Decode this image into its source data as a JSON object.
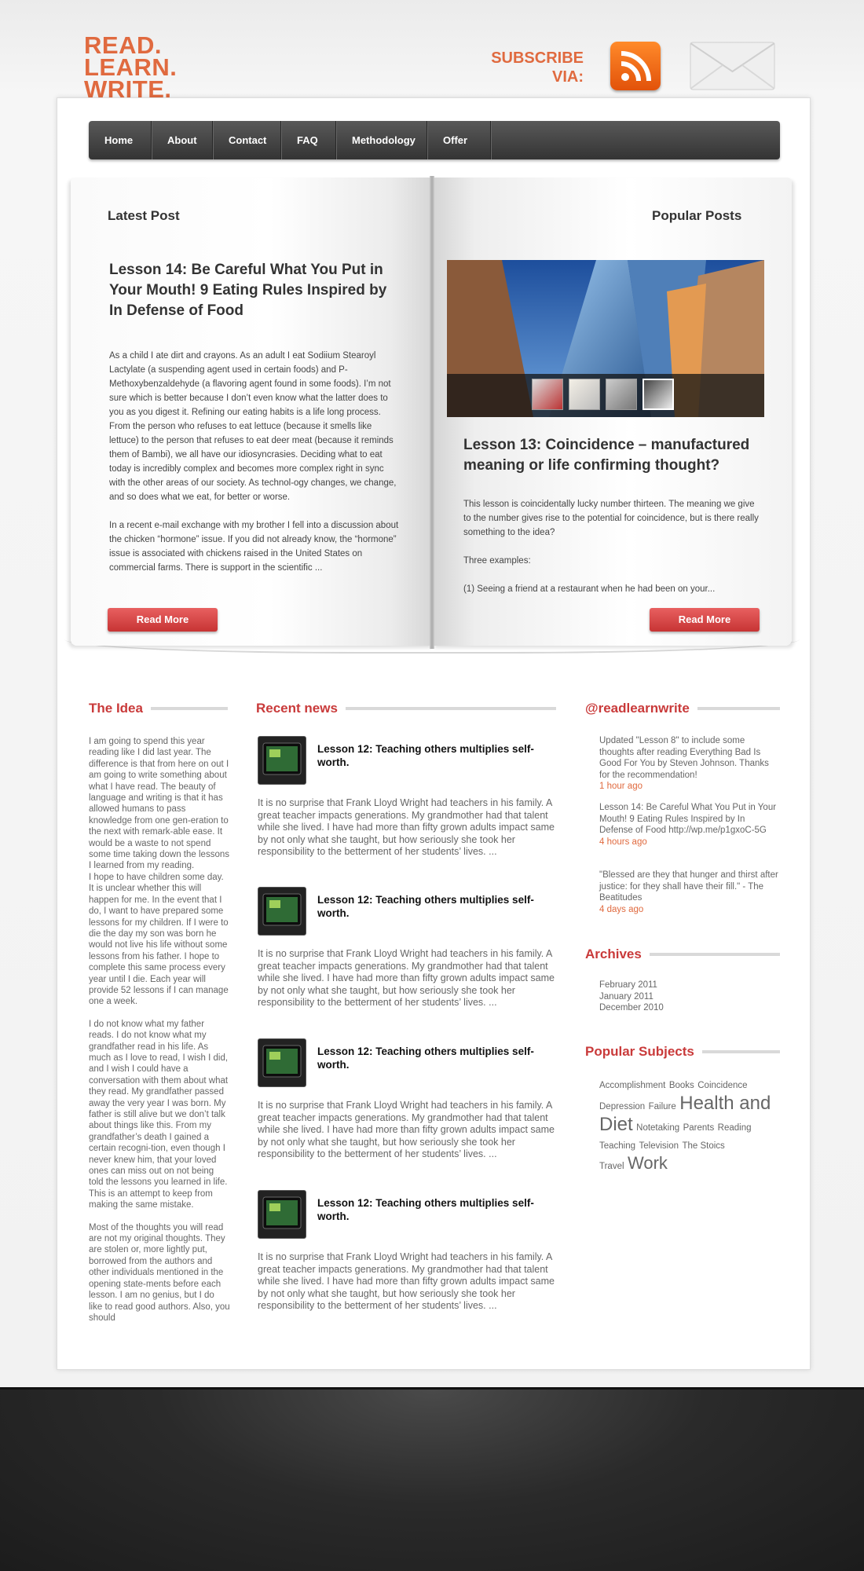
{
  "logo": {
    "line1": "READ.",
    "line2": "LEARN.",
    "line3": "WRITE."
  },
  "subscribe": {
    "line1": "SUBSCRIBE",
    "line2": "VIA:"
  },
  "nav": [
    "Home",
    "About",
    "Contact",
    "FAQ",
    "Methodology",
    "Offer"
  ],
  "latest": {
    "heading": "Latest Post",
    "title": "Lesson 14: Be Careful What You Put in Your Mouth! 9 Eating Rules Inspired by In Defense of Food",
    "p1": "As a child I ate dirt and crayons.  As an adult I eat Sodiium Stearoyl Lactylate (a suspending agent used in certain foods) and P-Methoxybenzaldehyde (a flavoring agent found in some foods). I’m not sure which is better because I don’t even know what the latter does to you as you digest it. Refining our eating habits is a life long process. From the person who refuses to eat lettuce (because it smells like lettuce) to the person that refuses to eat deer meat (because it reminds them of Bambi), we all have our idiosyncrasies. Deciding what to eat today is incredibly complex and becomes more complex right in sync with the other areas of our society.  As technol-ogy changes, we change, and so does what we eat, for better or worse.",
    "p2": "In a recent e-mail exchange with my brother I fell into a discussion about the chicken “hormone” issue.  If you did not already know, the “hormone” issue is associated with chickens raised in the United States on commercial farms. There is support in the scientific ...",
    "button": "Read More"
  },
  "popular": {
    "heading": "Popular Posts",
    "title": "Lesson 13: Coincidence – manufactured meaning or life confirming thought?",
    "p1": "This lesson is coincidentally lucky number thirteen.  The meaning we give to the number gives rise to the potential for coincidence, but is there really something to the idea?",
    "p2": "Three examples:",
    "p3": "(1) Seeing a friend at a restaurant when he had been on your...",
    "button": "Read More"
  },
  "idea": {
    "heading": "The Idea",
    "p1": "I am going to spend this year reading like I did last year. The difference is that from here on out I am going to write something about what I have read. The beauty of language and writing is that it has allowed humans to pass knowledge from one gen-eration to the next with remark-able ease. It would be a waste to not spend some time taking down the lessons I learned from my reading.",
    "p2": "I hope to have children some day. It is unclear whether this will happen for me. In the event that I do, I want to have prepared some lessons for my children. If I were to die the day my son was born he would not live his life without some lessons from his father. I hope to complete this same process every year until I die. Each year will provide 52 lessons if I can manage one a week.",
    "p3": "I do not know what my father reads. I do not know what my grandfather read in his life. As much as I love to read, I wish I did, and I wish I could have a conversation with them about what they read. My grandfather passed away the very year I was born. My father is still alive but we don’t talk about things like this. From my grandfather’s death I gained a certain recogni-tion, even though I never knew him, that your loved ones can miss out on not being told the lessons you learned in life. This is an attempt to keep from making the same mistake.",
    "p4": "Most of the thoughts you will read are not my original thoughts. They are stolen or, more lightly put, borrowed from the authors and other individuals mentioned in the opening state-ments before each lesson. I am no genius, but I do like to read good authors. Also, you should"
  },
  "news": {
    "heading": "Recent news",
    "items": [
      {
        "title": "Lesson 12: Teaching others multiplies self-worth.",
        "text": "It is no surprise that Frank Lloyd Wright had teachers in his family. A great teacher impacts generations. My grandmother had that talent while she lived. I have had more than fifty grown adults impact same by not only what she taught, but how seriously she took her responsibility to the betterment of her students’ lives. ..."
      },
      {
        "title": "Lesson 12: Teaching others multiplies self-worth.",
        "text": "It is no surprise that Frank Lloyd Wright had teachers in his family. A great teacher impacts generations. My grandmother had that talent while she lived. I have had more than fifty grown adults impact same by not only what she taught, but how seriously she took her responsibility to the betterment of her students’ lives. ..."
      },
      {
        "title": "Lesson 12: Teaching others multiplies self-worth.",
        "text": "It is no surprise that Frank Lloyd Wright had teachers in his family. A great teacher impacts generations. My grandmother had that talent while she lived. I have had more than fifty grown adults impact same by not only what she taught, but how seriously she took her responsibility to the betterment of her students’ lives. ..."
      },
      {
        "title": "Lesson 12: Teaching others multiplies self-worth.",
        "text": "It is no surprise that Frank Lloyd Wright had teachers in his family. A great teacher impacts generations. My grandmother had that talent while she lived. I have had more than fifty grown adults impact same by not only what she taught, but how seriously she took her responsibility to the betterment of her students’ lives. ..."
      }
    ]
  },
  "twitter": {
    "heading": "@readlearnwrite",
    "tweets": [
      {
        "text": "Updated \"Lesson 8\" to include some thoughts after reading Everything Bad Is Good For You by Steven Johnson. Thanks for the recommendation!",
        "ago": "1 hour ago"
      },
      {
        "text": "Lesson 14: Be Careful What You Put in Your Mouth! 9 Eating Rules Inspired by In Defense of Food http://wp.me/p1gxoC-5G",
        "ago": "4 hours ago"
      },
      {
        "text": "\"Blessed are they that hunger and thirst after justice: for they shall have their fill.\" - The Beatitudes",
        "ago": "4 days ago"
      }
    ]
  },
  "archives": {
    "heading": "Archives",
    "items": [
      "February 2011",
      "January 2011",
      "December 2010"
    ]
  },
  "subjects": {
    "heading": "Popular Subjects",
    "tags": [
      "Accomplishment",
      "Books",
      "Coincidence",
      "Depression",
      "Failure",
      "Health and Diet",
      "Notetaking",
      "Parents",
      "Reading",
      "Teaching",
      "Television",
      "The Stoics",
      "Travel",
      "Work"
    ]
  },
  "colors": {
    "accent": "#c93a3a",
    "brand": "#e06a3f",
    "nav": "#3f3f3f"
  }
}
